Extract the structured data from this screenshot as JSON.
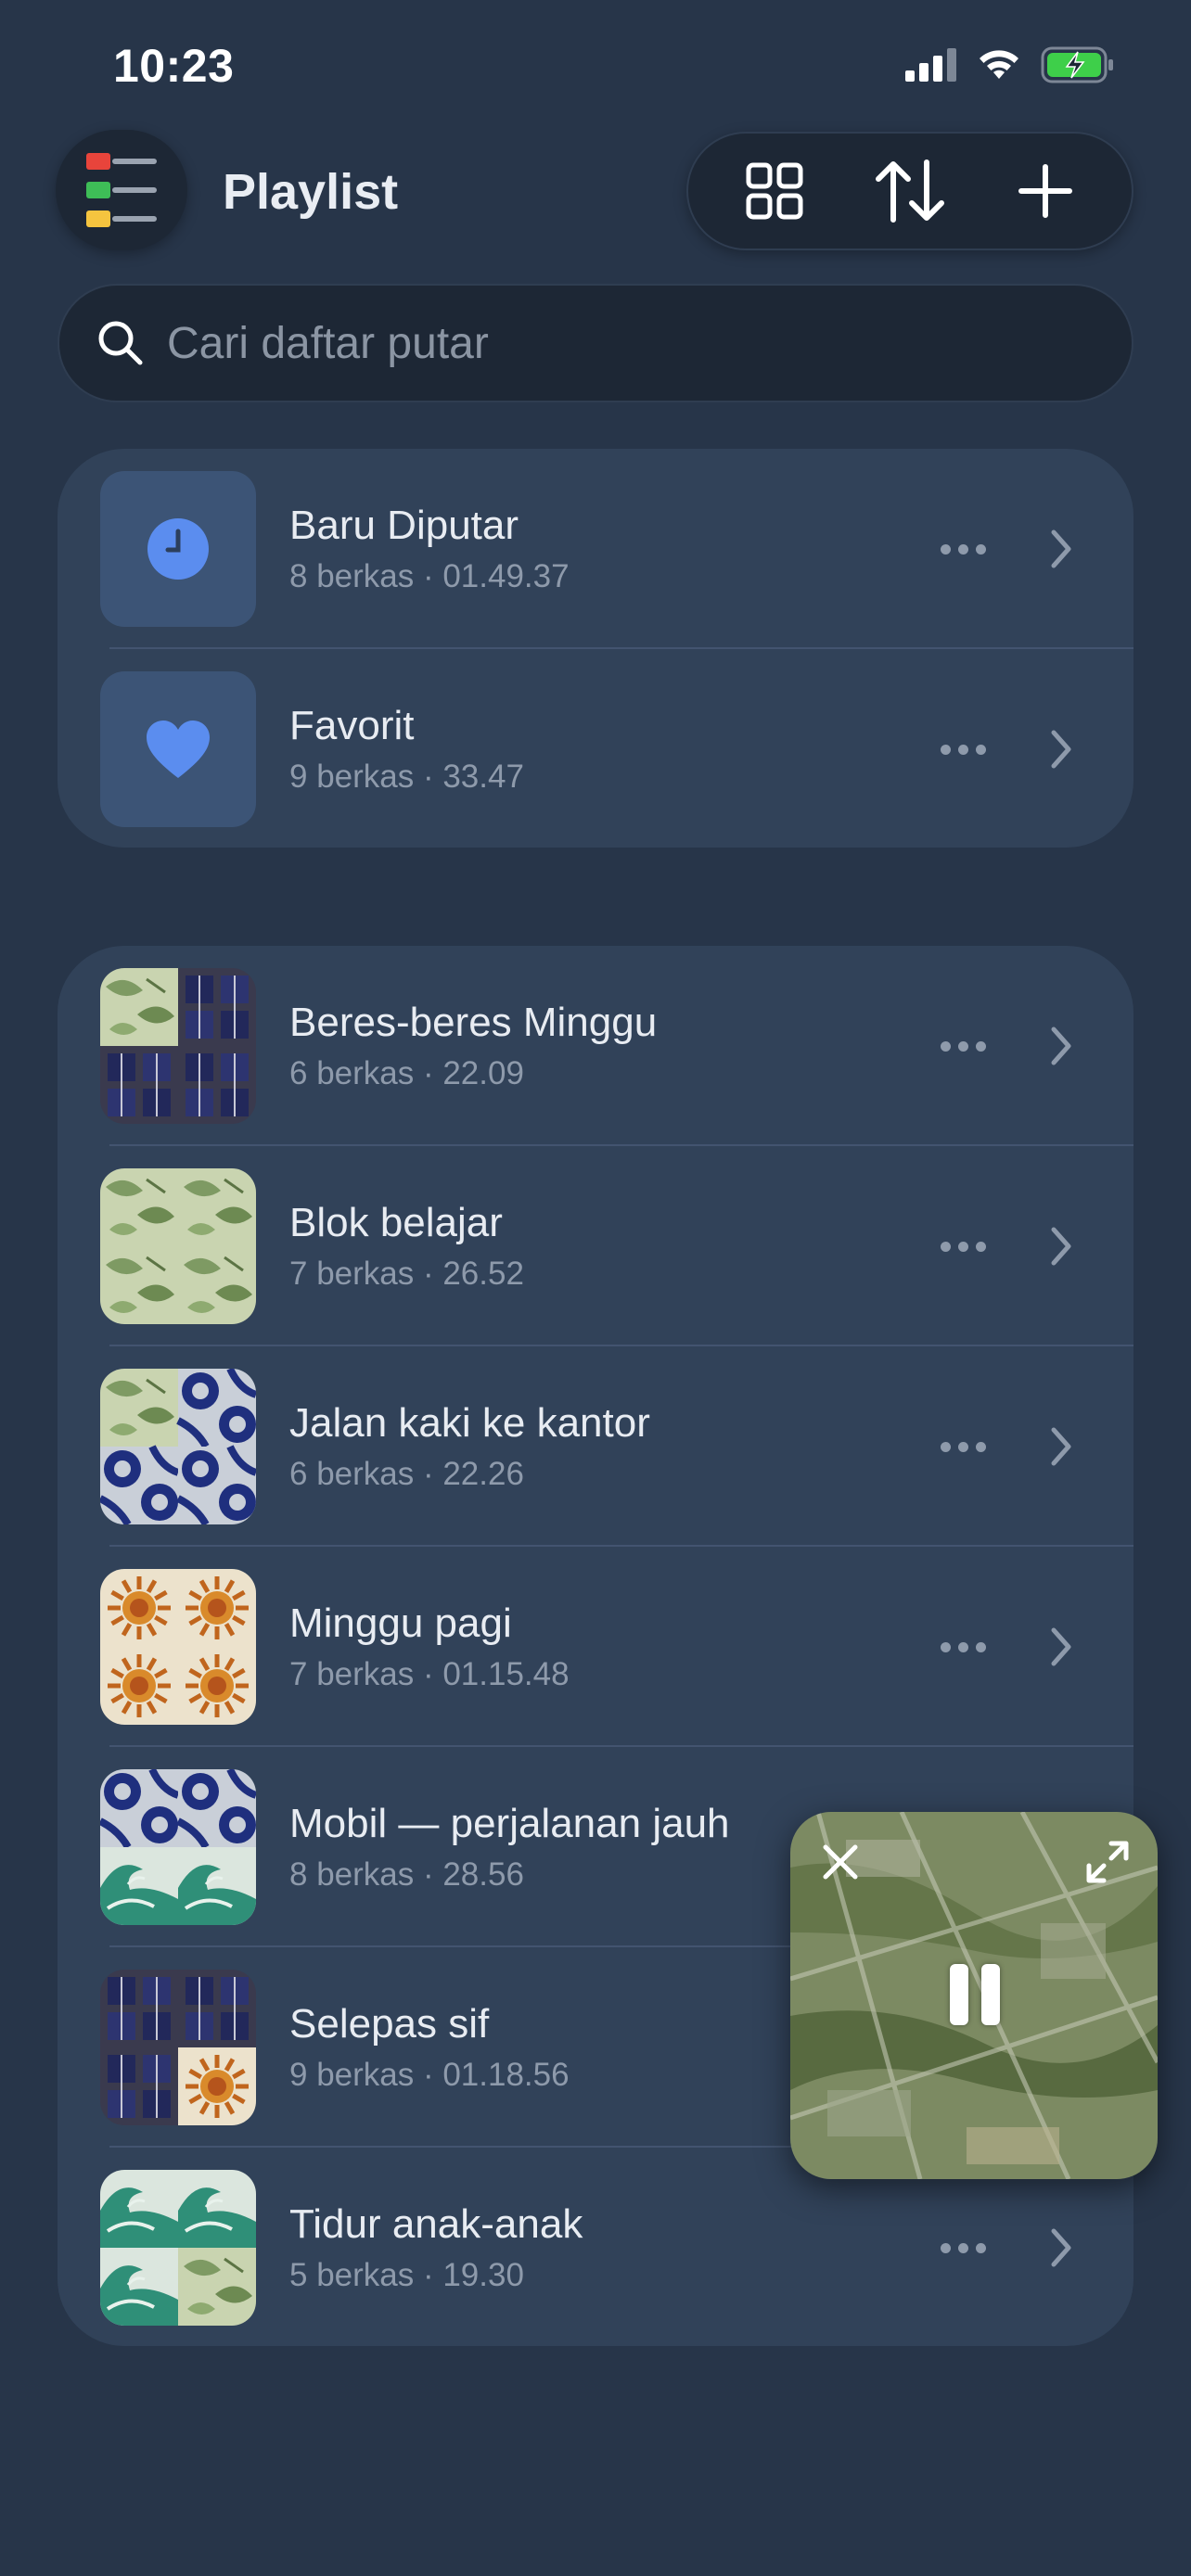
{
  "status_bar": {
    "time": "10:23",
    "icons": [
      "signal-icon",
      "wifi-icon",
      "battery-charging-icon"
    ],
    "battery_color": "#3ecf4a"
  },
  "header": {
    "title": "Playlist",
    "menu_icon": "menu-colored-lines-icon",
    "actions": [
      "grid-view-icon",
      "sort-icon",
      "add-icon"
    ]
  },
  "search": {
    "placeholder": "Cari daftar putar"
  },
  "system_playlists": [
    {
      "name": "Baru Diputar",
      "meta": "8 berkas · 01.49.37",
      "icon": "clock-icon"
    },
    {
      "name": "Favorit",
      "meta": "9 berkas · 33.47",
      "icon": "heart-icon"
    }
  ],
  "playlists": [
    {
      "name": "Beres-beres Minggu",
      "meta": "6 berkas · 22.09",
      "art": [
        "leaf",
        "building",
        "building",
        "building"
      ]
    },
    {
      "name": "Blok belajar",
      "meta": "7 berkas · 26.52",
      "art": [
        "leaf",
        "leaf",
        "leaf",
        "leaf"
      ]
    },
    {
      "name": "Jalan kaki ke kantor",
      "meta": "6 berkas · 22.26",
      "art": [
        "leaf",
        "tile",
        "tile",
        "tile"
      ]
    },
    {
      "name": "Minggu pagi",
      "meta": "7 berkas · 01.15.48",
      "art": [
        "sun",
        "sun",
        "sun",
        "sun"
      ]
    },
    {
      "name": "Mobil — perjalanan jauh",
      "meta": "8 berkas · 28.56",
      "art": [
        "tile",
        "tile",
        "wave",
        "wave"
      ]
    },
    {
      "name": "Selepas sif",
      "meta": "9 berkas · 01.18.56",
      "art": [
        "building",
        "building",
        "building",
        "sun"
      ]
    },
    {
      "name": "Tidur anak-anak",
      "meta": "5 berkas · 19.30",
      "art": [
        "wave",
        "wave",
        "wave",
        "leaf"
      ]
    }
  ],
  "mini_player": {
    "state": "playing",
    "icons": [
      "close-icon",
      "expand-icon",
      "pause-icon"
    ]
  },
  "colors": {
    "background": "#273549",
    "card": "#314259",
    "accent": "#5b8def",
    "pill": "#1d2735"
  }
}
